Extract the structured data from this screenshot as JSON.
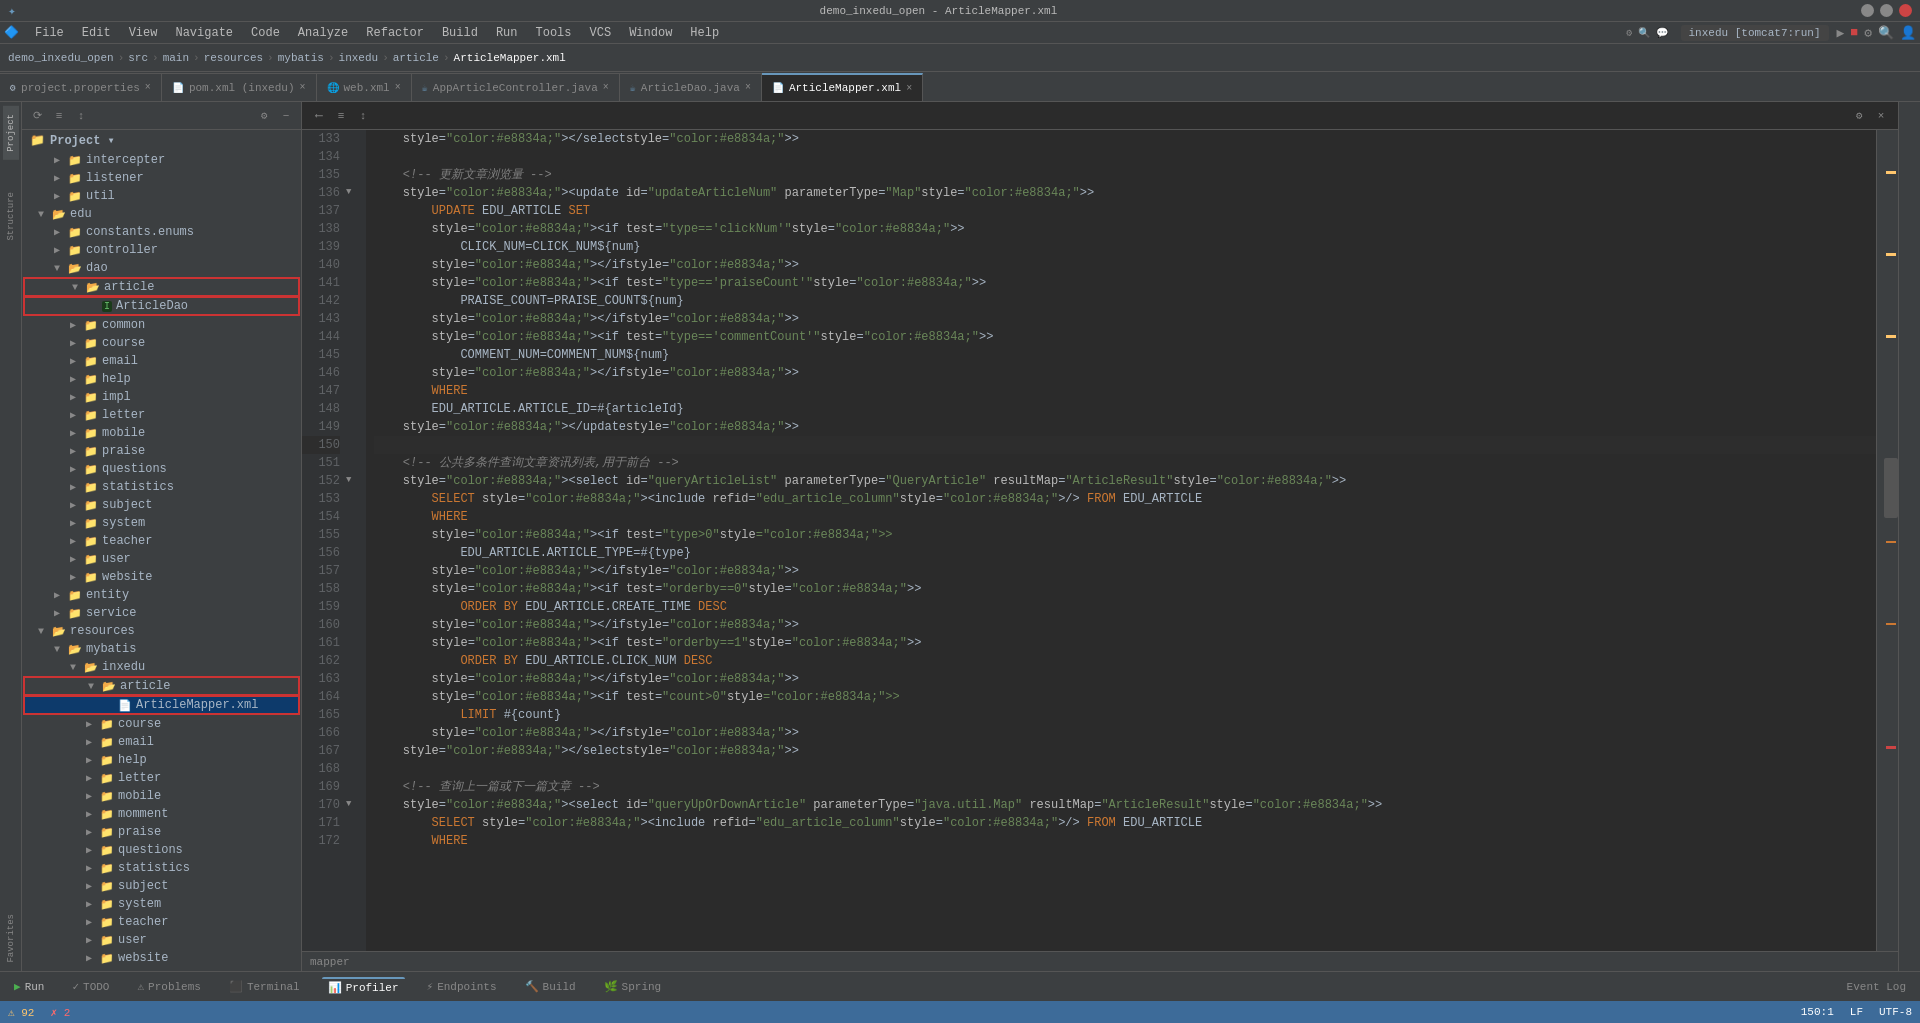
{
  "titleBar": {
    "title": "demo_inxedu_open - ArticleMapper.xml",
    "menuItems": [
      "File",
      "Edit",
      "View",
      "Navigate",
      "Code",
      "Analyze",
      "Refactor",
      "Build",
      "Run",
      "Tools",
      "VCS",
      "Window",
      "Help"
    ]
  },
  "breadcrumb": {
    "items": [
      "demo_inxedu_open",
      "src",
      "main",
      "resources",
      "mybatis",
      "inxedu",
      "article",
      "ArticleMapper.xml"
    ]
  },
  "tabs": [
    {
      "label": "project.properties",
      "icon": "⚙",
      "active": false,
      "modified": false
    },
    {
      "label": "pom.xml (inxedu)",
      "icon": "📄",
      "active": false,
      "modified": false
    },
    {
      "label": "web.xml",
      "icon": "🌐",
      "active": false,
      "modified": false
    },
    {
      "label": "AppArticleController.java",
      "icon": "☕",
      "active": false,
      "modified": false
    },
    {
      "label": "ArticleDao.java",
      "icon": "☕",
      "active": false,
      "modified": false
    },
    {
      "label": "ArticleMapper.xml",
      "icon": "📄",
      "active": true,
      "modified": false
    }
  ],
  "sidebar": {
    "projectLabel": "Project ▾",
    "treeItems": [
      {
        "indent": 2,
        "hasArrow": true,
        "open": false,
        "name": "intercepter",
        "type": "folder"
      },
      {
        "indent": 2,
        "hasArrow": true,
        "open": false,
        "name": "listener",
        "type": "folder"
      },
      {
        "indent": 2,
        "hasArrow": true,
        "open": false,
        "name": "util",
        "type": "folder"
      },
      {
        "indent": 1,
        "hasArrow": true,
        "open": true,
        "name": "edu",
        "type": "folder"
      },
      {
        "indent": 2,
        "hasArrow": true,
        "open": false,
        "name": "constants.enums",
        "type": "folder"
      },
      {
        "indent": 2,
        "hasArrow": true,
        "open": false,
        "name": "controller",
        "type": "folder"
      },
      {
        "indent": 2,
        "hasArrow": true,
        "open": true,
        "name": "dao",
        "type": "folder"
      },
      {
        "indent": 3,
        "hasArrow": true,
        "open": true,
        "name": "article",
        "type": "folder",
        "highlighted": true
      },
      {
        "indent": 4,
        "hasArrow": false,
        "name": "ArticleDao",
        "type": "java-interface",
        "highlighted": true
      },
      {
        "indent": 3,
        "hasArrow": true,
        "open": false,
        "name": "common",
        "type": "folder"
      },
      {
        "indent": 3,
        "hasArrow": true,
        "open": false,
        "name": "course",
        "type": "folder"
      },
      {
        "indent": 3,
        "hasArrow": true,
        "open": false,
        "name": "email",
        "type": "folder"
      },
      {
        "indent": 3,
        "hasArrow": true,
        "open": false,
        "name": "help",
        "type": "folder"
      },
      {
        "indent": 3,
        "hasArrow": true,
        "open": false,
        "name": "impl",
        "type": "folder"
      },
      {
        "indent": 3,
        "hasArrow": true,
        "open": false,
        "name": "letter",
        "type": "folder"
      },
      {
        "indent": 3,
        "hasArrow": true,
        "open": false,
        "name": "mobile",
        "type": "folder"
      },
      {
        "indent": 3,
        "hasArrow": true,
        "open": false,
        "name": "praise",
        "type": "folder"
      },
      {
        "indent": 3,
        "hasArrow": true,
        "open": false,
        "name": "questions",
        "type": "folder"
      },
      {
        "indent": 3,
        "hasArrow": true,
        "open": false,
        "name": "statistics",
        "type": "folder"
      },
      {
        "indent": 3,
        "hasArrow": true,
        "open": false,
        "name": "subject",
        "type": "folder"
      },
      {
        "indent": 3,
        "hasArrow": true,
        "open": false,
        "name": "system",
        "type": "folder"
      },
      {
        "indent": 3,
        "hasArrow": true,
        "open": false,
        "name": "teacher",
        "type": "folder"
      },
      {
        "indent": 3,
        "hasArrow": true,
        "open": false,
        "name": "user",
        "type": "folder"
      },
      {
        "indent": 3,
        "hasArrow": true,
        "open": false,
        "name": "website",
        "type": "folder"
      },
      {
        "indent": 2,
        "hasArrow": true,
        "open": false,
        "name": "entity",
        "type": "folder"
      },
      {
        "indent": 2,
        "hasArrow": true,
        "open": false,
        "name": "service",
        "type": "folder"
      },
      {
        "indent": 1,
        "hasArrow": true,
        "open": true,
        "name": "resources",
        "type": "folder"
      },
      {
        "indent": 2,
        "hasArrow": true,
        "open": true,
        "name": "mybatis",
        "type": "folder"
      },
      {
        "indent": 3,
        "hasArrow": true,
        "open": true,
        "name": "inxedu",
        "type": "folder"
      },
      {
        "indent": 4,
        "hasArrow": true,
        "open": true,
        "name": "article",
        "type": "folder",
        "highlighted": true
      },
      {
        "indent": 5,
        "hasArrow": false,
        "name": "ArticleMapper.xml",
        "type": "xml",
        "highlighted": true,
        "selected": true
      },
      {
        "indent": 4,
        "hasArrow": true,
        "open": false,
        "name": "course",
        "type": "folder"
      },
      {
        "indent": 4,
        "hasArrow": true,
        "open": false,
        "name": "email",
        "type": "folder"
      },
      {
        "indent": 4,
        "hasArrow": true,
        "open": false,
        "name": "help",
        "type": "folder"
      },
      {
        "indent": 4,
        "hasArrow": true,
        "open": false,
        "name": "letter",
        "type": "folder"
      },
      {
        "indent": 4,
        "hasArrow": true,
        "open": false,
        "name": "mobile",
        "type": "folder"
      },
      {
        "indent": 4,
        "hasArrow": true,
        "open": false,
        "name": "momment",
        "type": "folder"
      },
      {
        "indent": 4,
        "hasArrow": true,
        "open": false,
        "name": "praise",
        "type": "folder"
      },
      {
        "indent": 4,
        "hasArrow": true,
        "open": false,
        "name": "questions",
        "type": "folder"
      },
      {
        "indent": 4,
        "hasArrow": true,
        "open": false,
        "name": "statistics",
        "type": "folder"
      },
      {
        "indent": 4,
        "hasArrow": true,
        "open": false,
        "name": "subject",
        "type": "folder"
      },
      {
        "indent": 4,
        "hasArrow": true,
        "open": false,
        "name": "system",
        "type": "folder"
      },
      {
        "indent": 4,
        "hasArrow": true,
        "open": false,
        "name": "teacher",
        "type": "folder"
      },
      {
        "indent": 4,
        "hasArrow": true,
        "open": false,
        "name": "user",
        "type": "folder"
      },
      {
        "indent": 4,
        "hasArrow": true,
        "open": false,
        "name": "website",
        "type": "folder"
      }
    ]
  },
  "editor": {
    "filename": "ArticleMapper.xml",
    "bottomLabel": "mapper",
    "lines": [
      {
        "num": 133,
        "content": "    </select>"
      },
      {
        "num": 134,
        "content": ""
      },
      {
        "num": 135,
        "content": "    <!-- 更新文章浏览量 -->"
      },
      {
        "num": 136,
        "content": "    <update id=\"updateArticleNum\" parameterType=\"Map\">"
      },
      {
        "num": 137,
        "content": "        UPDATE EDU_ARTICLE SET"
      },
      {
        "num": 138,
        "content": "        <if test=\"type=='clickNum'\">"
      },
      {
        "num": 139,
        "content": "            CLICK_NUM=CLICK_NUM${num}"
      },
      {
        "num": 140,
        "content": "        </if>"
      },
      {
        "num": 141,
        "content": "        <if test=\"type=='praiseCount'\">"
      },
      {
        "num": 142,
        "content": "            PRAISE_COUNT=PRAISE_COUNT${num}"
      },
      {
        "num": 143,
        "content": "        </if>"
      },
      {
        "num": 144,
        "content": "        <if test=\"type=='commentCount'\">"
      },
      {
        "num": 145,
        "content": "            COMMENT_NUM=COMMENT_NUM${num}"
      },
      {
        "num": 146,
        "content": "        </if>"
      },
      {
        "num": 147,
        "content": "        WHERE"
      },
      {
        "num": 148,
        "content": "        EDU_ARTICLE.ARTICLE_ID=#{articleId}"
      },
      {
        "num": 149,
        "content": "    </update>"
      },
      {
        "num": 150,
        "content": ""
      },
      {
        "num": 151,
        "content": "    <!-- 公共多条件查询文章资讯列表,用于前台 -->"
      },
      {
        "num": 152,
        "content": "    <select id=\"queryArticleList\" parameterType=\"QueryArticle\" resultMap=\"ArticleResult\">"
      },
      {
        "num": 153,
        "content": "        SELECT <include refid=\"edu_article_column\"/> FROM EDU_ARTICLE"
      },
      {
        "num": 154,
        "content": "        WHERE"
      },
      {
        "num": 155,
        "content": "        <if test=\"type>0\">"
      },
      {
        "num": 156,
        "content": "            EDU_ARTICLE.ARTICLE_TYPE=#{type}"
      },
      {
        "num": 157,
        "content": "        </if>"
      },
      {
        "num": 158,
        "content": "        <if test=\"orderby==0\">"
      },
      {
        "num": 159,
        "content": "            ORDER BY EDU_ARTICLE.CREATE_TIME DESC"
      },
      {
        "num": 160,
        "content": "        </if>"
      },
      {
        "num": 161,
        "content": "        <if test=\"orderby==1\">"
      },
      {
        "num": 162,
        "content": "            ORDER BY EDU_ARTICLE.CLICK_NUM DESC"
      },
      {
        "num": 163,
        "content": "        </if>"
      },
      {
        "num": 164,
        "content": "        <if test=\"count>0\">"
      },
      {
        "num": 165,
        "content": "            LIMIT #{count}"
      },
      {
        "num": 166,
        "content": "        </if>"
      },
      {
        "num": 167,
        "content": "    </select>"
      },
      {
        "num": 168,
        "content": ""
      },
      {
        "num": 169,
        "content": "    <!-- 查询上一篇或下一篇文章 -->"
      },
      {
        "num": 170,
        "content": "    <select id=\"queryUpOrDownArticle\" parameterType=\"java.util.Map\" resultMap=\"ArticleResult\">"
      },
      {
        "num": 171,
        "content": "        SELECT <include refid=\"edu_article_column\"/> FROM EDU_ARTICLE"
      },
      {
        "num": 172,
        "content": "        WHERE"
      }
    ]
  },
  "statusBar": {
    "warnings": "⚠ 92",
    "errors": "2",
    "encoding": "UTF-8",
    "lineEnding": "LF",
    "position": "150:1",
    "scrollPercent": "47%"
  },
  "bottomPanel": {
    "tabs": [
      {
        "label": "▶ Run",
        "icon": "▶"
      },
      {
        "label": "✓ TODO"
      },
      {
        "label": "⚠ Problems"
      },
      {
        "label": "Terminal"
      },
      {
        "label": "Profiler",
        "active": true
      },
      {
        "label": "Endpoints"
      },
      {
        "label": "Build"
      },
      {
        "label": "Spring"
      }
    ],
    "rightTabs": [
      "Event Log"
    ]
  },
  "inxeduServer": "inxedu [tomcat7:run]"
}
